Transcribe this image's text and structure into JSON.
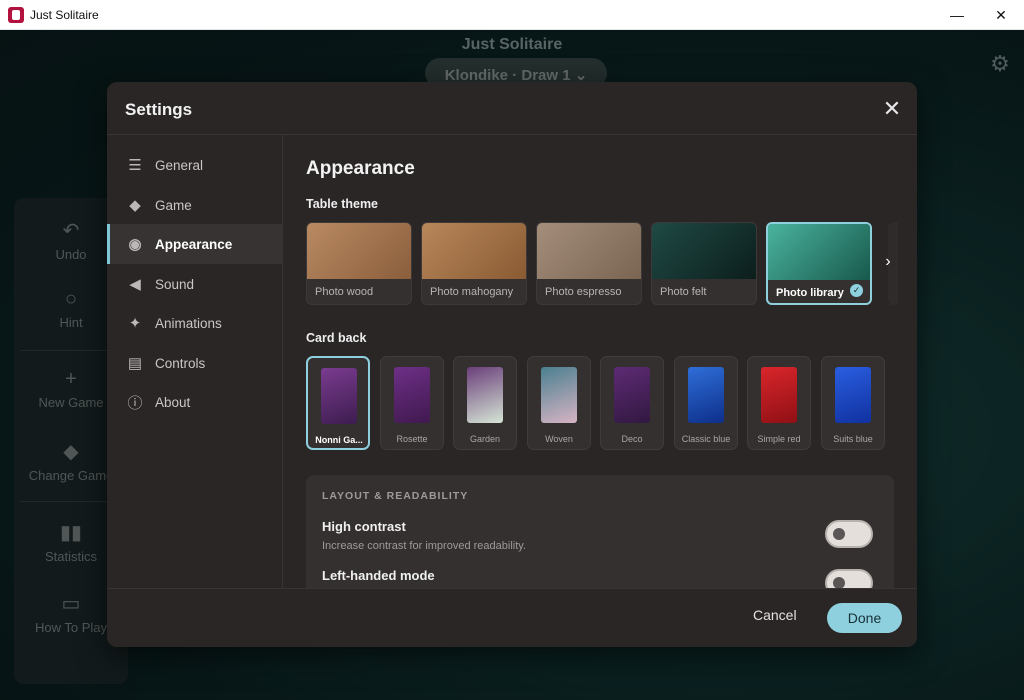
{
  "window": {
    "title": "Just Solitaire",
    "minimize_icon": "—",
    "maximize_icon": "☐",
    "close_icon": "✕"
  },
  "game": {
    "title": "Just Solitaire",
    "variant_button": "Klondike · Draw 1 ⌄",
    "toolbar": [
      {
        "label": "Undo",
        "icon": "↶"
      },
      {
        "label": "Hint",
        "icon": "💡"
      },
      {
        "label": "New Game",
        "icon": "+"
      },
      {
        "label": "Change Game",
        "icon": "🂠"
      },
      {
        "label": "Statistics",
        "icon": "▮"
      },
      {
        "label": "How To Play",
        "icon": "📖"
      }
    ]
  },
  "settings": {
    "title": "Settings",
    "nav": [
      {
        "label": "General",
        "icon": "sliders-icon"
      },
      {
        "label": "Game",
        "icon": "cards-icon"
      },
      {
        "label": "Appearance",
        "icon": "palette-icon"
      },
      {
        "label": "Sound",
        "icon": "speaker-icon"
      },
      {
        "label": "Animations",
        "icon": "sparkle-icon"
      },
      {
        "label": "Controls",
        "icon": "keyboard-icon"
      },
      {
        "label": "About",
        "icon": "info-icon"
      }
    ],
    "active_nav": "Appearance",
    "section_title": "Appearance",
    "table_theme_label": "Table theme",
    "themes": [
      {
        "label": "Photo wood",
        "color_a": "#b98a62",
        "color_b": "#8b5e3c"
      },
      {
        "label": "Photo mahogany",
        "color_a": "#b8875a",
        "color_b": "#8a5a33"
      },
      {
        "label": "Photo espresso",
        "color_a": "#a48e7b",
        "color_b": "#7a6552"
      },
      {
        "label": "Photo felt",
        "color_a": "#1f4a45",
        "color_b": "#0c1e1c"
      },
      {
        "label": "Photo library",
        "color_a": "#4ab39e",
        "color_b": "#17584b"
      }
    ],
    "selected_theme": "Photo library",
    "card_back_label": "Card back",
    "card_backs": [
      {
        "label": "Nonni Ga...",
        "color_a": "#7a3b8f",
        "color_b": "#3d1d4f"
      },
      {
        "label": "Rosette",
        "color_a": "#6d2f86",
        "color_b": "#40194f"
      },
      {
        "label": "Garden",
        "color_a": "#6a3e7a",
        "color_b": "#d6e6d6"
      },
      {
        "label": "Woven",
        "color_a": "#4b7f8f",
        "color_b": "#d6b4c4"
      },
      {
        "label": "Deco",
        "color_a": "#5d2b74",
        "color_b": "#321841"
      },
      {
        "label": "Classic blue",
        "color_a": "#2f6ed8",
        "color_b": "#0d2f8a"
      },
      {
        "label": "Simple red",
        "color_a": "#d9262b",
        "color_b": "#8f1015"
      },
      {
        "label": "Suits blue",
        "color_a": "#2a5ee0",
        "color_b": "#1031a0"
      }
    ],
    "selected_card_back": "Nonni Ga...",
    "panel": {
      "title": "LAYOUT & READABILITY",
      "options": [
        {
          "label": "High contrast",
          "description": "Increase contrast for improved readability.",
          "enabled": false
        },
        {
          "label": "Left-handed mode",
          "description": "",
          "enabled": false
        }
      ]
    },
    "cancel_label": "Cancel",
    "done_label": "Done"
  },
  "colors": {
    "accent": "#8fd0de",
    "modal_bg": "#2a2626",
    "panel_bg": "#343030"
  }
}
